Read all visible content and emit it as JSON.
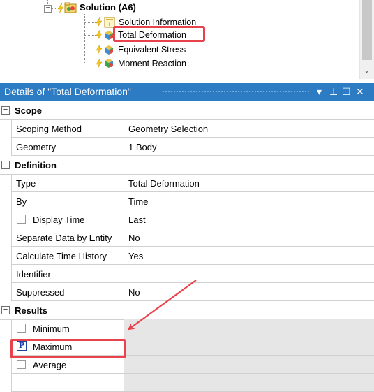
{
  "tree": {
    "solution_label": "Solution (A6)",
    "children": [
      {
        "label": "Solution Information",
        "icon": "solution-info-icon"
      },
      {
        "label": "Total Deformation",
        "icon": "deformation-result-icon"
      },
      {
        "label": "Equivalent Stress",
        "icon": "stress-result-icon"
      },
      {
        "label": "Moment Reaction",
        "icon": "reaction-probe-icon"
      }
    ],
    "scroll_down_glyph": "⌄"
  },
  "details": {
    "title": "Details of \"Total Deformation\"",
    "buttons": {
      "dropdown": "▾",
      "pin": "⊥",
      "maximize": "☐",
      "close": "✕"
    },
    "toggle_glyph": "−",
    "categories": {
      "scope": "Scope",
      "definition": "Definition",
      "results": "Results"
    },
    "rows": {
      "scoping_method": {
        "prop": "Scoping Method",
        "value": "Geometry Selection"
      },
      "geometry": {
        "prop": "Geometry",
        "value": "1 Body"
      },
      "type": {
        "prop": "Type",
        "value": "Total Deformation"
      },
      "by": {
        "prop": "By",
        "value": "Time"
      },
      "display_time": {
        "prop": "Display Time",
        "value": "Last"
      },
      "separate_data": {
        "prop": "Separate Data by Entity",
        "value": "No"
      },
      "calc_time_history": {
        "prop": "Calculate Time History",
        "value": "Yes"
      },
      "identifier": {
        "prop": "Identifier",
        "value": ""
      },
      "suppressed": {
        "prop": "Suppressed",
        "value": "No"
      },
      "minimum": {
        "prop": "Minimum",
        "value": ""
      },
      "maximum": {
        "prop": "Maximum",
        "value": "",
        "parameter_glyph": "P"
      },
      "average": {
        "prop": "Average",
        "value": ""
      }
    }
  },
  "colors": {
    "header_bg": "#2d7bc3",
    "highlight": "#e8434d",
    "readonly_cell": "#e6e6e6"
  }
}
